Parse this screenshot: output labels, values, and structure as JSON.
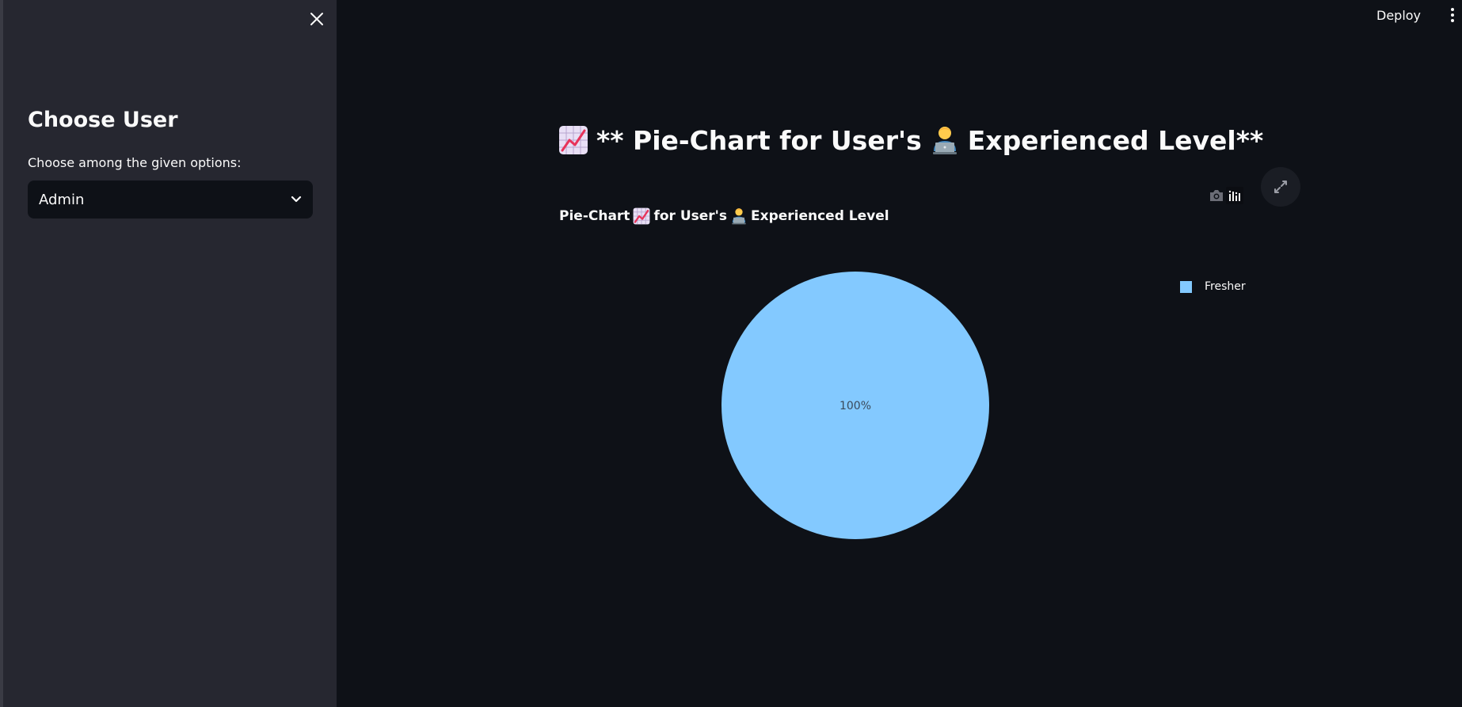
{
  "app": {
    "deploy_label": "Deploy"
  },
  "sidebar": {
    "heading": "Choose User",
    "select_label": "Choose among the given options:",
    "select_value": "Admin"
  },
  "main": {
    "page_title": {
      "prefix": "** Pie-Chart for User's",
      "suffix": "Experienced Level**"
    },
    "chart_heading": {
      "part1": "Pie-Chart",
      "part2": "for User's",
      "part3": "Experienced Level"
    },
    "icons": {
      "chart": "chart-increasing-emoji",
      "user": "technologist-emoji",
      "camera": "camera-icon",
      "modebar": "plotly-logo-icon",
      "fullscreen": "fullscreen-icon"
    }
  },
  "chart_data": {
    "type": "pie",
    "title": "Pie-Chart for User's Experienced Level",
    "categories": [
      "Fresher"
    ],
    "values": [
      100
    ],
    "labels": [
      "100%"
    ],
    "colors": [
      "#83c9ff"
    ],
    "legend": {
      "position": "top-right",
      "entries": [
        "Fresher"
      ]
    }
  }
}
